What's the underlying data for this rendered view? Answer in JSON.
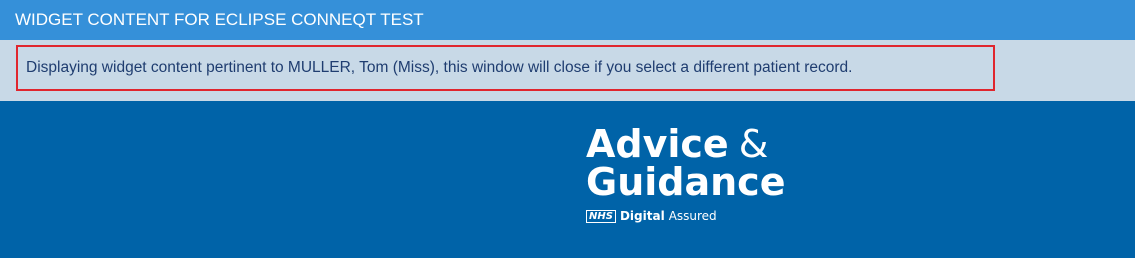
{
  "window": {
    "title": "WIDGET CONTENT FOR ECLIPSE CONNEQT TEST"
  },
  "notice": {
    "text": "Displaying widget content pertinent to MULLER, Tom (Miss), this window will close if you select a different patient record."
  },
  "logo": {
    "line1_word": "Advice",
    "line1_amp": "&",
    "line2_word": "Guidance",
    "nhs_badge": "NHS",
    "digital": "Digital",
    "assured": "Assured"
  },
  "colors": {
    "titlebar": "#3590d9",
    "info_band": "#c8d9e7",
    "highlight_border": "#e0262e",
    "content_bg": "#0063a8"
  }
}
